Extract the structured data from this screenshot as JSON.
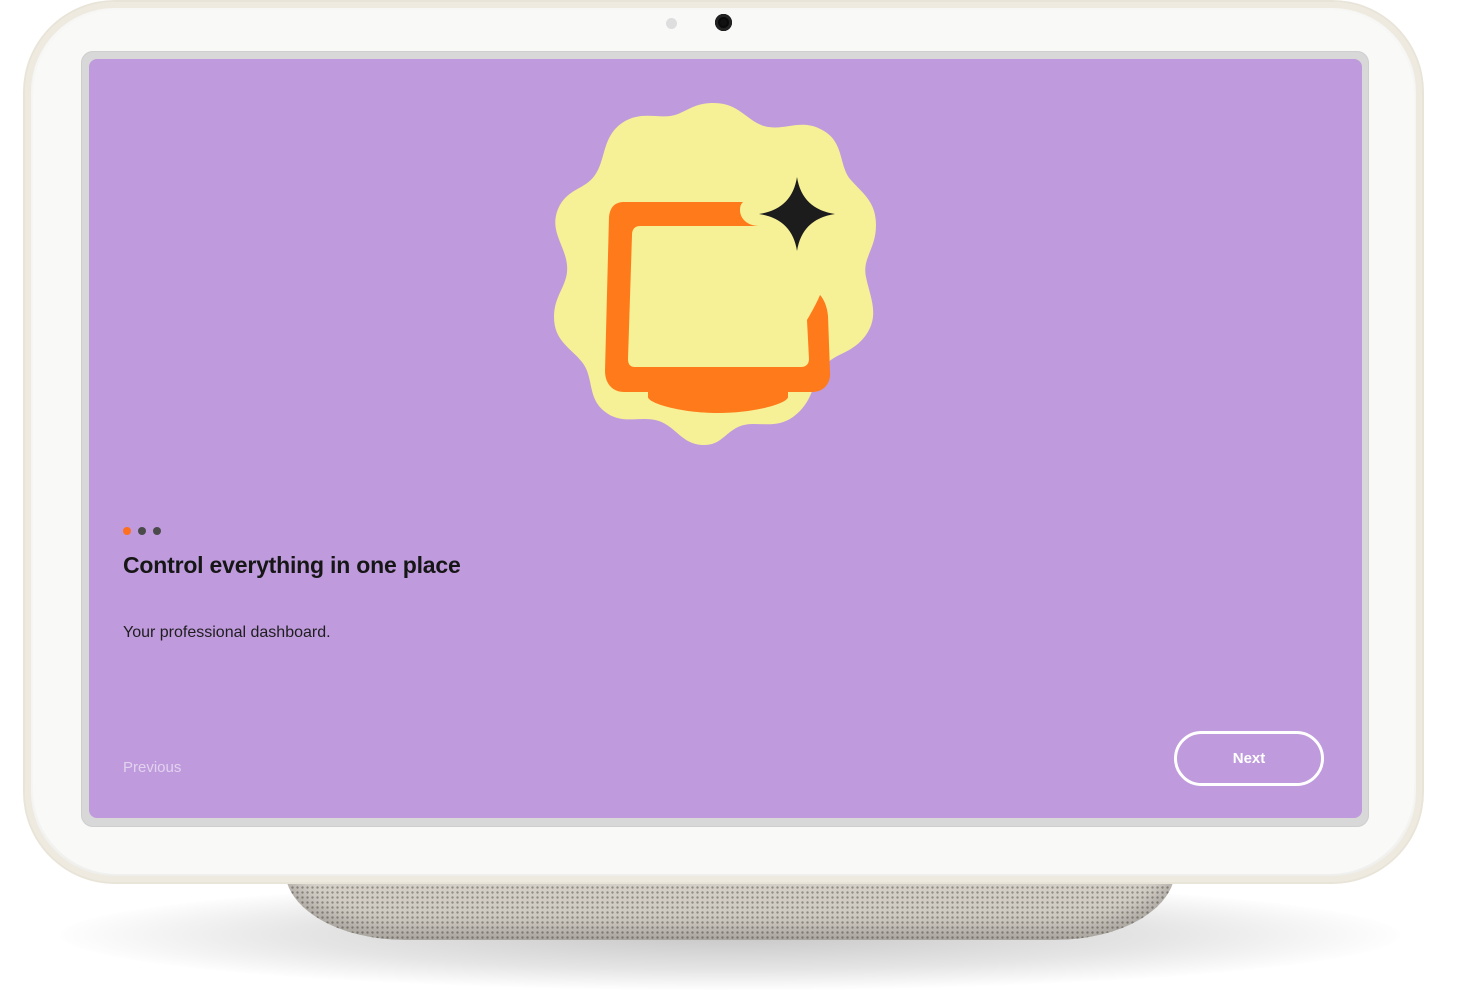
{
  "onboarding": {
    "illustration_icon": "monitor-with-sparkle-icon",
    "pager": {
      "total": 3,
      "current": 1,
      "active_color": "#ff6f20",
      "inactive_color": "#4a4a4a"
    },
    "title": "Control everything in one place",
    "description": "Your professional dashboard.",
    "previous_label": "Previous",
    "next_label": "Next"
  },
  "colors": {
    "screen_background": "#bf9adc",
    "badge": "#f6f096",
    "monitor": "#ff7a1a",
    "sparkle": "#1c1c1c",
    "device_frame": "#f7f7f5"
  }
}
